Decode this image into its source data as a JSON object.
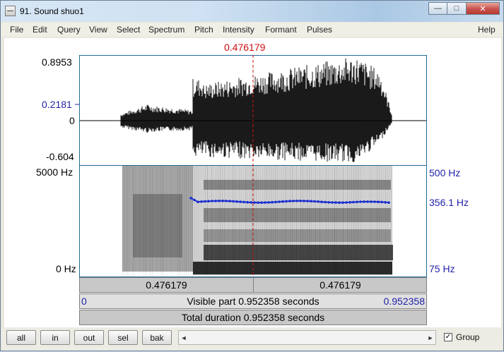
{
  "window": {
    "title": "91. Sound shuo1",
    "minimize_glyph": "—",
    "maximize_glyph": "□",
    "close_glyph": "✕"
  },
  "menu": {
    "items": [
      "File",
      "Edit",
      "Query",
      "View",
      "Select",
      "Spectrum",
      "Pitch",
      "Intensity",
      "Formant",
      "Pulses"
    ],
    "help": "Help"
  },
  "cursor": {
    "time_label": "0.476179"
  },
  "waveform": {
    "y_max_label": "0.8953",
    "y_cursor_label": "0.2181",
    "y_zero_label": "0",
    "y_min_label": "-0.604"
  },
  "spectrogram": {
    "freq_top_label": "5000 Hz",
    "freq_bottom_label": "0 Hz",
    "pitch_top_label": "500 Hz",
    "pitch_cursor_label": "356.1 Hz",
    "pitch_bottom_label": "75 Hz",
    "pitch_color": "#1a2fd0"
  },
  "info": {
    "left_half": "0.476179",
    "right_half": "0.476179",
    "visible_start": "0",
    "visible_text": "Visible part 0.952358 seconds",
    "visible_end": "0.952358",
    "total_text": "Total duration 0.952358 seconds"
  },
  "bottom": {
    "buttons": [
      "all",
      "in",
      "out",
      "sel",
      "bak"
    ],
    "scroll_left_glyph": "◄",
    "scroll_right_glyph": "►",
    "group_label": "Group",
    "group_checked": true,
    "check_glyph": "✓"
  },
  "colors": {
    "cursor": "#cc1010",
    "axis_blue": "#2222aa",
    "panel_border": "#1f6b96"
  }
}
